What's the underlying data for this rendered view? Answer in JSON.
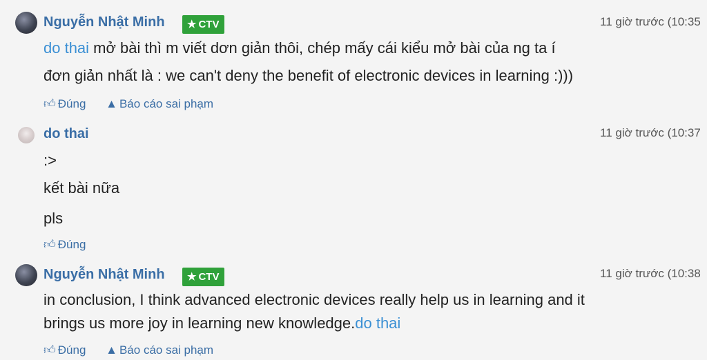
{
  "comments": [
    {
      "author": "Nguyễn Nhật Minh",
      "badge": "CTV",
      "time": "11 giờ trước (10:35",
      "lines": [
        {
          "mention": "do thai",
          "text": " mở bài thì m viết dơn giản thôi, chép mấy cái kiểu mở bài của ng ta í"
        },
        {
          "text": "đơn giản nhất là : we can't deny the benefit of electronic devices in learning :)))"
        }
      ],
      "actions": {
        "like": "Đúng",
        "report": "Báo cáo sai phạm"
      }
    },
    {
      "author": "do thai",
      "time": "11 giờ trước (10:37",
      "lines": [
        ":>",
        "kết bài nữa",
        "pls"
      ],
      "actions": {
        "like": "Đúng"
      }
    },
    {
      "author": "Nguyễn Nhật Minh",
      "badge": "CTV",
      "time": "11 giờ trước (10:38",
      "lines": [
        {
          "text": "in conclusion, I think advanced electronic devices really help us in learning and it"
        },
        {
          "text": "brings us more joy in learning new knowledge.",
          "mention": "do thai"
        }
      ],
      "actions": {
        "like": "Đúng",
        "report": "Báo cáo sai phạm"
      }
    }
  ],
  "icons": {
    "like": "thumbs-up-icon",
    "report": "warning-icon",
    "badge": "star-icon"
  },
  "colors": {
    "name": "#3a6ea6",
    "mention": "#3a8fd4",
    "badge": "#2fa13a",
    "action": "#3b6ea5"
  }
}
